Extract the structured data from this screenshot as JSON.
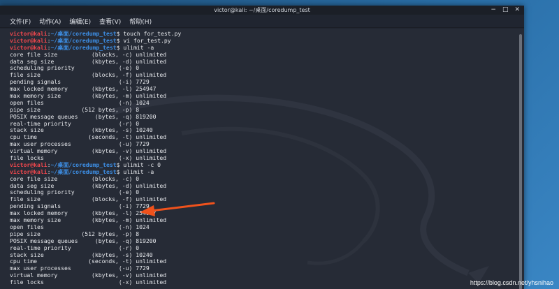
{
  "window": {
    "title": "victor@kali: ~/桌面/coredump_test",
    "controls": [
      "−",
      "□",
      "✕"
    ]
  },
  "menu": [
    "文件(F)",
    "动作(A)",
    "编辑(E)",
    "查看(V)",
    "帮助(H)"
  ],
  "prompt": {
    "user": "victor@kali",
    "path": "~/桌面/coredump_test"
  },
  "lines": [
    {
      "type": "prompt",
      "cmd": "touch for_test.py"
    },
    {
      "type": "prompt",
      "cmd": "vi for_test.py"
    },
    {
      "type": "prompt",
      "cmd": "ulimit -a"
    },
    {
      "type": "out",
      "text": "core file size          (blocks, -c) unlimited"
    },
    {
      "type": "out",
      "text": "data seg size           (kbytes, -d) unlimited"
    },
    {
      "type": "out",
      "text": "scheduling priority             (-e) 0"
    },
    {
      "type": "out",
      "text": "file size               (blocks, -f) unlimited"
    },
    {
      "type": "out",
      "text": "pending signals                 (-i) 7729"
    },
    {
      "type": "out",
      "text": "max locked memory       (kbytes, -l) 254947"
    },
    {
      "type": "out",
      "text": "max memory size         (kbytes, -m) unlimited"
    },
    {
      "type": "out",
      "text": "open files                      (-n) 1024"
    },
    {
      "type": "out",
      "text": "pipe size            (512 bytes, -p) 8"
    },
    {
      "type": "out",
      "text": "POSIX message queues     (bytes, -q) 819200"
    },
    {
      "type": "out",
      "text": "real-time priority              (-r) 0"
    },
    {
      "type": "out",
      "text": "stack size              (kbytes, -s) 10240"
    },
    {
      "type": "out",
      "text": "cpu time               (seconds, -t) unlimited"
    },
    {
      "type": "out",
      "text": "max user processes              (-u) 7729"
    },
    {
      "type": "out",
      "text": "virtual memory          (kbytes, -v) unlimited"
    },
    {
      "type": "out",
      "text": "file locks                      (-x) unlimited"
    },
    {
      "type": "prompt",
      "cmd": "ulimit -c 0"
    },
    {
      "type": "prompt",
      "cmd": "ulimit -a"
    },
    {
      "type": "out",
      "text": "core file size          (blocks, -c) 0"
    },
    {
      "type": "out",
      "text": "data seg size           (kbytes, -d) unlimited"
    },
    {
      "type": "out",
      "text": "scheduling priority             (-e) 0"
    },
    {
      "type": "out",
      "text": "file size               (blocks, -f) unlimited"
    },
    {
      "type": "out",
      "text": "pending signals                 (-i) 7729"
    },
    {
      "type": "out",
      "text": "max locked memory       (kbytes, -l) 254947"
    },
    {
      "type": "out",
      "text": "max memory size         (kbytes, -m) unlimited"
    },
    {
      "type": "out",
      "text": "open files                      (-n) 1024"
    },
    {
      "type": "out",
      "text": "pipe size            (512 bytes, -p) 8"
    },
    {
      "type": "out",
      "text": "POSIX message queues     (bytes, -q) 819200"
    },
    {
      "type": "out",
      "text": "real-time priority              (-r) 0"
    },
    {
      "type": "out",
      "text": "stack size              (kbytes, -s) 10240"
    },
    {
      "type": "out",
      "text": "cpu time               (seconds, -t) unlimited"
    },
    {
      "type": "out",
      "text": "max user processes              (-u) 7729"
    },
    {
      "type": "out",
      "text": "virtual memory          (kbytes, -v) unlimited"
    },
    {
      "type": "out",
      "text": "file locks                      (-x) unlimited"
    }
  ],
  "watermark": "https://blog.csdn.net/yhsnihao",
  "colors": {
    "user": "#f0474d",
    "path": "#3d8fe6",
    "arrow": "#f0521c"
  },
  "annotation": {
    "shape": "arrow",
    "target": "core file size value 0"
  }
}
